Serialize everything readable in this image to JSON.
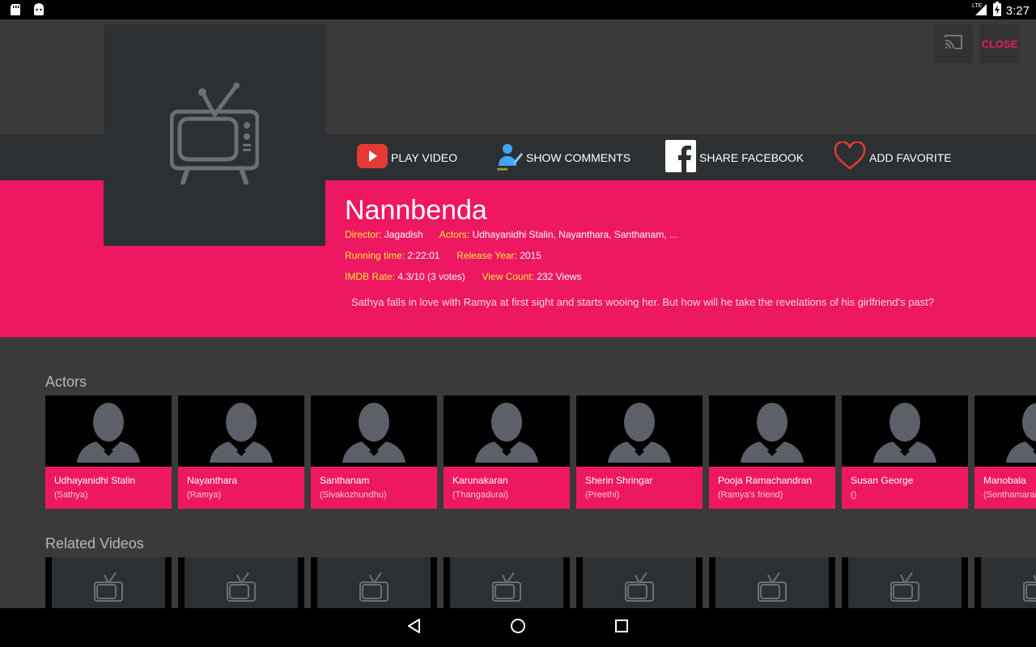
{
  "status": {
    "time": "3:27",
    "network": "LTE"
  },
  "top_buttons": {
    "close_label": "CLOSE"
  },
  "actions": {
    "play": "PLAY VIDEO",
    "comments": "SHOW COMMENTS",
    "facebook": "SHARE FACEBOOK",
    "favorite": "ADD FAVORITE",
    "stars": "*****"
  },
  "movie": {
    "title": "Nannbenda",
    "director_label": "Director:",
    "director": "Jagadish",
    "actors_label": "Actors:",
    "actors": "Udhayanidhi Stalin, Nayanthara, Santhanam, ...",
    "running_label": "Running time:",
    "running": "2:22:01",
    "year_label": "Release Year:",
    "year": "2015",
    "imdb_label": "IMDB Rate:",
    "imdb": "4.3/10 (3 votes)",
    "views_label": "View Count:",
    "views": "232 Views",
    "description": "Sathya falls in love with Ramya at first sight and starts wooing her. But how will he take the revelations of his girlfriend's past?"
  },
  "sections": {
    "actors": "Actors",
    "related": "Related Videos"
  },
  "actors": [
    {
      "name": "Udhayanidhi Stalin",
      "role": "(Sathya)"
    },
    {
      "name": "Nayanthara",
      "role": "(Ramya)"
    },
    {
      "name": "Santhanam",
      "role": "(Sivakozhundhu)"
    },
    {
      "name": "Karunakaran",
      "role": "(Thangadurai)"
    },
    {
      "name": "Sherin Shringar",
      "role": "(Preethi)"
    },
    {
      "name": "Pooja Ramachandran",
      "role": "(Ramya's friend)"
    },
    {
      "name": "Susan George",
      "role": "()"
    },
    {
      "name": "Manobala",
      "role": "(Senthamarai)"
    }
  ],
  "colors": {
    "accent": "#ee1762",
    "panel": "#2c3033",
    "background": "#3b3a38",
    "label_yellow": "#ffeb3b"
  }
}
